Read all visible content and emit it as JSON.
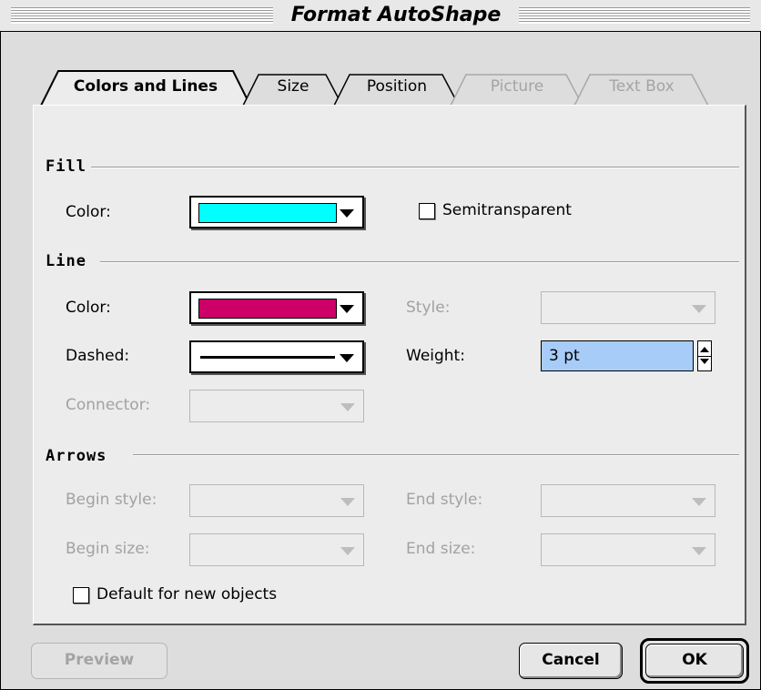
{
  "window": {
    "title": "Format AutoShape"
  },
  "tabs": [
    {
      "label": "Colors and Lines",
      "active": true,
      "enabled": true
    },
    {
      "label": "Size",
      "active": false,
      "enabled": true
    },
    {
      "label": "Position",
      "active": false,
      "enabled": true
    },
    {
      "label": "Picture",
      "active": false,
      "enabled": false
    },
    {
      "label": "Text Box",
      "active": false,
      "enabled": false
    }
  ],
  "fill": {
    "section_title": "Fill",
    "color_label": "Color:",
    "color_value": "#00ffff",
    "semitransparent_label": "Semitransparent",
    "semitransparent_checked": false
  },
  "line": {
    "section_title": "Line",
    "color_label": "Color:",
    "color_value": "#cc0066",
    "dashed_label": "Dashed:",
    "connector_label": "Connector:",
    "style_label": "Style:",
    "weight_label": "Weight:",
    "weight_value": "3 pt"
  },
  "arrows": {
    "section_title": "Arrows",
    "begin_style_label": "Begin style:",
    "begin_size_label": "Begin size:",
    "end_style_label": "End style:",
    "end_size_label": "End size:"
  },
  "default_checkbox": {
    "label": "Default for new objects",
    "checked": false
  },
  "buttons": {
    "preview": "Preview",
    "cancel": "Cancel",
    "ok": "OK"
  }
}
